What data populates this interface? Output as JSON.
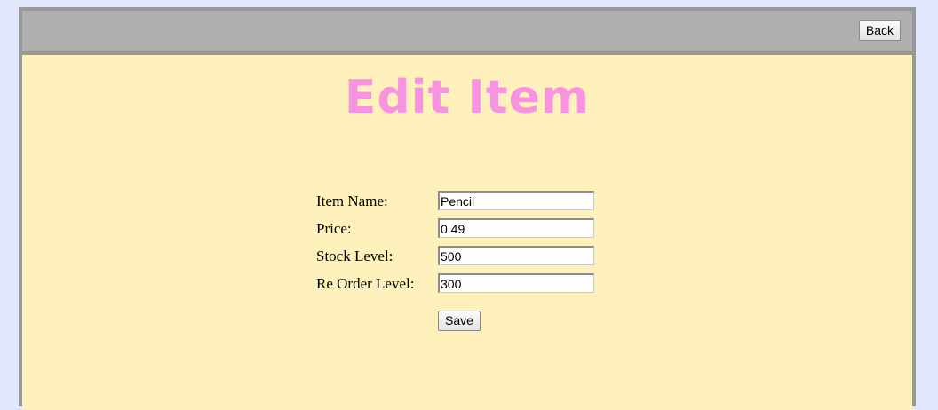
{
  "header": {
    "back_label": "Back"
  },
  "page": {
    "title": "Edit Item"
  },
  "form": {
    "fields": [
      {
        "label": "Item Name:",
        "value": "Pencil"
      },
      {
        "label": "Price:",
        "value": "0.49"
      },
      {
        "label": "Stock Level:",
        "value": "500"
      },
      {
        "label": "Re Order Level:",
        "value": "300"
      }
    ],
    "save_label": "Save"
  },
  "colors": {
    "page_background": "#e1e8fe",
    "frame_border": "#999999",
    "header_bar": "#b0b0b0",
    "content_background": "#fef1bc",
    "title_color": "#f893e2"
  }
}
